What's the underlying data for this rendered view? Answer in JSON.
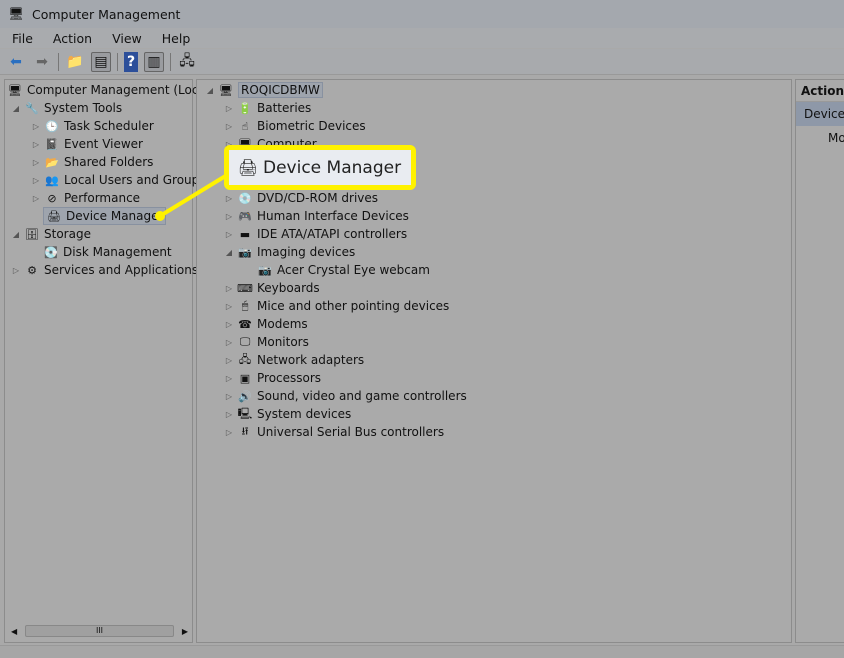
{
  "window": {
    "title": "Computer Management"
  },
  "menu": [
    "File",
    "Action",
    "View",
    "Help"
  ],
  "toolbar": {
    "icons": [
      "back-arrow-icon",
      "forward-arrow-icon",
      "up-folder-icon",
      "show-hide-tree-icon",
      "help-icon",
      "show-hide-action-pane-icon",
      "computer-connect-icon"
    ]
  },
  "left_tree": {
    "root": "Computer Management (Local",
    "system_tools": "System Tools",
    "task_scheduler": "Task Scheduler",
    "event_viewer": "Event Viewer",
    "shared_folders": "Shared Folders",
    "local_users": "Local Users and Groups",
    "performance": "Performance",
    "device_manager": "Device Manager",
    "storage": "Storage",
    "disk_management": "Disk Management",
    "services": "Services and Applications"
  },
  "device_tree": {
    "root": "ROQICDBMW",
    "items": [
      "Batteries",
      "Biometric Devices",
      "Computer",
      "DVD/CD-ROM drives",
      "Human Interface Devices",
      "IDE ATA/ATAPI controllers",
      "Imaging devices",
      "Acer Crystal Eye webcam",
      "Keyboards",
      "Mice and other pointing devices",
      "Modems",
      "Monitors",
      "Network adapters",
      "Processors",
      "Sound, video and game controllers",
      "System devices",
      "Universal Serial Bus controllers"
    ]
  },
  "actions": {
    "header": "Actions",
    "item": "Device M",
    "sub": "Mo"
  },
  "callout": {
    "label": "Device Manager",
    "color": "#fff200"
  },
  "scrollbar": {
    "grip": "III"
  }
}
